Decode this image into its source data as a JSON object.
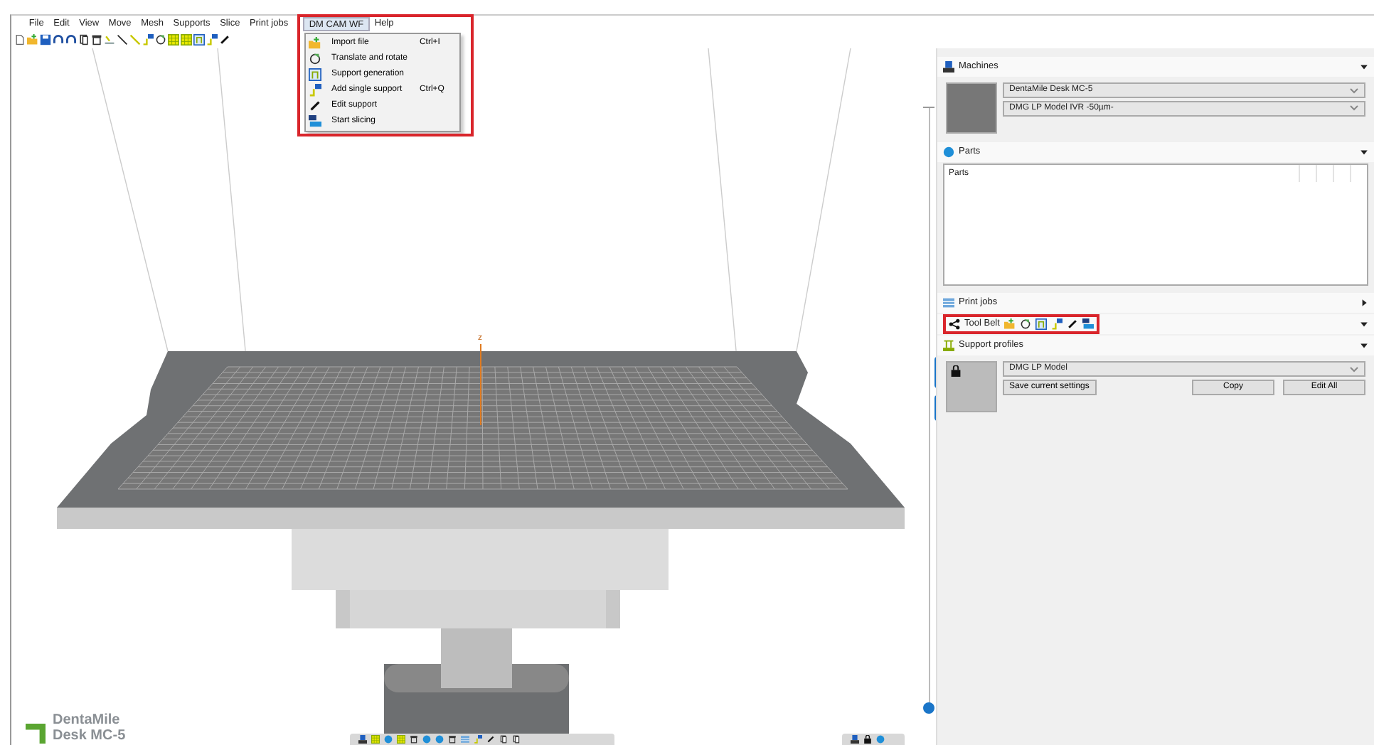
{
  "menu_bar": [
    {
      "label": "File",
      "selected": false
    },
    {
      "label": "Edit",
      "selected": false
    },
    {
      "label": "View",
      "selected": false
    },
    {
      "label": "Move",
      "selected": false
    },
    {
      "label": "Mesh",
      "selected": false
    },
    {
      "label": "Supports",
      "selected": false
    },
    {
      "label": "Slice",
      "selected": false
    },
    {
      "label": "Print jobs",
      "selected": false
    },
    {
      "label": "DM CAM WF",
      "selected": true
    },
    {
      "label": "Help",
      "selected": false
    }
  ],
  "open_menu": {
    "items": [
      {
        "label": "Import file",
        "shortcut": "Ctrl+I"
      },
      {
        "label": "Translate and rotate"
      },
      {
        "label": "Support generation"
      },
      {
        "label": "Add single support",
        "shortcut": "Ctrl+Q"
      },
      {
        "label": "Edit support"
      },
      {
        "label": "Start slicing"
      }
    ]
  },
  "viewport": {
    "axis_label": "z",
    "layer_slider": {
      "level": 0
    }
  },
  "logo": {
    "lines": [
      "DentaMile",
      "Desk MC-5"
    ]
  },
  "panels": [
    {
      "kind": "machines",
      "title": "Machines",
      "expanded": true,
      "printer": "DentaMile Desk MC-5",
      "material": "DMG LP Model IVR -50µm-"
    },
    {
      "kind": "parts",
      "title": "Parts",
      "expanded": true,
      "column": "Parts"
    },
    {
      "kind": "print_jobs",
      "title": "Print jobs",
      "expanded": false
    },
    {
      "kind": "tool_belt",
      "title": "Tool Belt",
      "expanded": true
    },
    {
      "kind": "support_profiles",
      "title": "Support profiles",
      "expanded": true,
      "profile": "DMG LP Model",
      "buttons": [
        "Save current settings",
        "Copy",
        "Edit All"
      ]
    }
  ]
}
